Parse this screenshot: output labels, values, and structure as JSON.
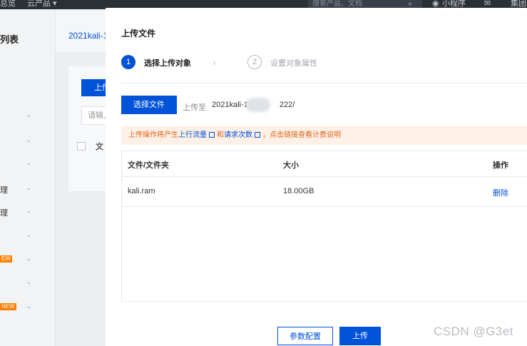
{
  "topnav": {
    "item1": "总览",
    "item2": "云产品 ▾",
    "search_placeholder": "搜索产品、文档",
    "search_icon": "search-icon",
    "mini_program": "小程序",
    "mail_icon": "mail-icon",
    "group": "集团"
  },
  "sidebar": {
    "title": "列表",
    "item_manage": "理",
    "item_other": "理",
    "new_badge_1": "EW",
    "new_badge_2": "NEW"
  },
  "background": {
    "bucket": "2021kali-1",
    "upload_btn": "上传",
    "search_placeholder": "请输入",
    "col_file": "文"
  },
  "modal": {
    "title": "上传文件",
    "steps": [
      {
        "num": "1",
        "label": "选择上传对象"
      },
      {
        "num": "2",
        "label": "设置对象属性"
      }
    ],
    "select_file_button": "选择文件",
    "upload_to_label": "上传至",
    "upload_path_prefix": "2021kali-13",
    "upload_path_suffix": "222/",
    "notice": {
      "prefix": "上传操作将产生",
      "link1": "上行流量",
      "mid": "和",
      "link2": "请求次数",
      "suffix": "，点击链接查看计费说明"
    },
    "table": {
      "headers": [
        "文件/文件夹",
        "大小",
        "操作"
      ],
      "rows": [
        {
          "name": "kali.ram",
          "size": "18.00GB",
          "action": "删除"
        }
      ]
    },
    "config_button": "参数配置",
    "upload_button": "上传"
  },
  "watermark": "CSDN @G3et",
  "colors": {
    "primary": "#0052d9",
    "warning_bg": "#fdf0e6",
    "warning_text": "#e0641a"
  }
}
